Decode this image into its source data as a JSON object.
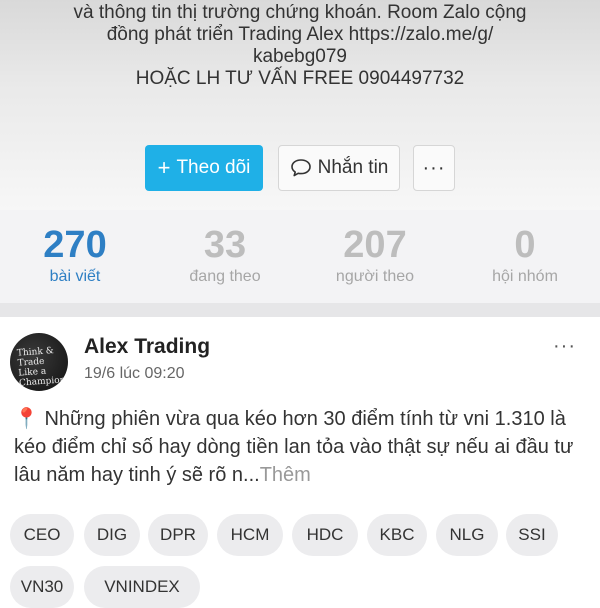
{
  "bio": {
    "lines": [
      "và thông tin thị trường chứng khoán. Room Zalo cộng",
      "đồng phát triển Trading Alex https://zalo.me/g/",
      "kabebg079",
      "HOẶC LH TƯ VẤN FREE 0904497732"
    ]
  },
  "actions": {
    "follow_label": "Theo dõi",
    "message_label": "Nhắn tin",
    "more_label": "···"
  },
  "stats": [
    {
      "value": "270",
      "label": "bài viết"
    },
    {
      "value": "33",
      "label": "đang theo"
    },
    {
      "value": "207",
      "label": "người theo"
    },
    {
      "value": "0",
      "label": "hội nhóm"
    }
  ],
  "post": {
    "author": "Alex Trading",
    "time": "19/6 lúc 09:20",
    "more_label": "···",
    "avatar_text": "Think & Trade Like a Champion",
    "pin_icon": "📍",
    "text": " Những phiên vừa qua kéo hơn 30 điểm tính từ vni 1.310 là kéo điểm chỉ số hay dòng tiền lan tỏa vào thật sự nếu ai đầu tư lâu năm hay tinh ý sẽ rõ n...",
    "more_text": "Thêm",
    "tags": [
      "CEO",
      "DIG",
      "DPR",
      "HCM",
      "HDC",
      "KBC",
      "NLG",
      "SSI",
      "VN30",
      "VNINDEX"
    ]
  },
  "colors": {
    "accent": "#1fb0e7",
    "stat_active": "#2e7fc4"
  },
  "icons": {
    "follow": "plus-icon",
    "message": "chat-bubble-icon",
    "more": "more-dots-icon",
    "pin": "pin-icon"
  }
}
